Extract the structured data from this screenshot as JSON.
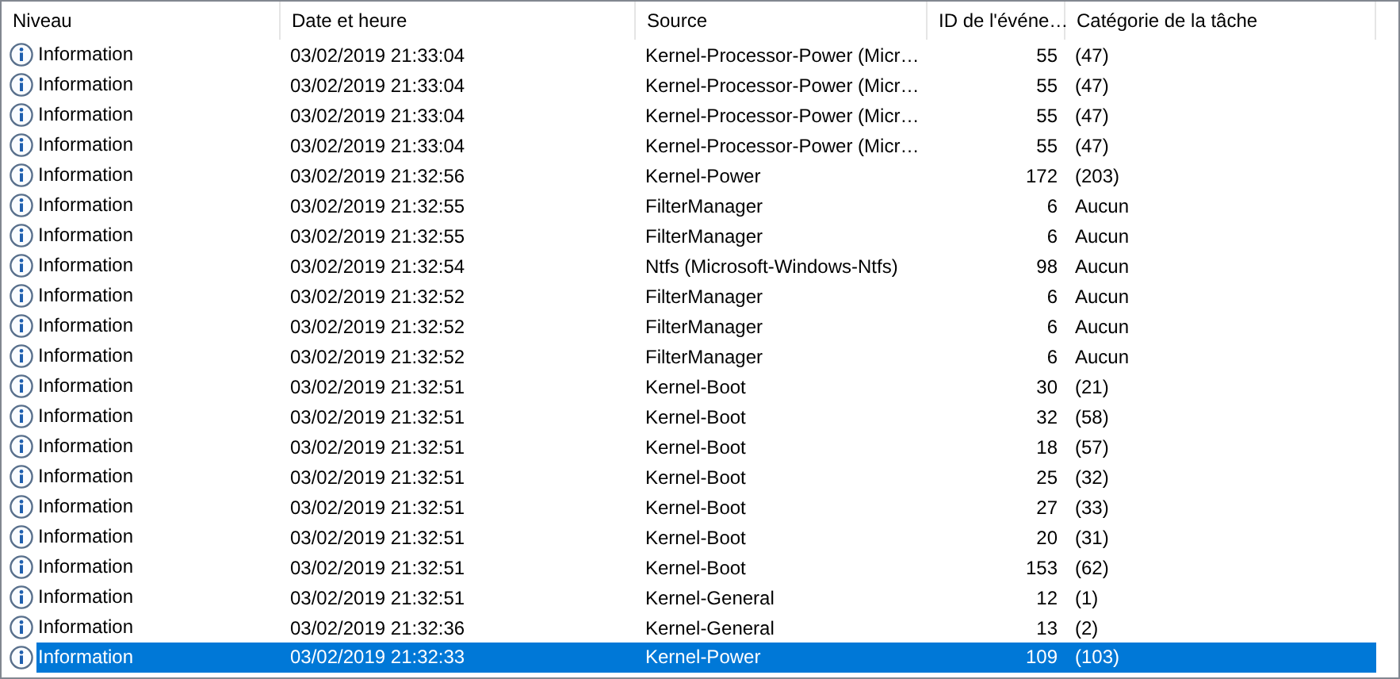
{
  "table": {
    "columns": [
      "Niveau",
      "Date et heure",
      "Source",
      "ID de l'événe…",
      "Catégorie de la tâche"
    ],
    "rows": [
      {
        "level": "Information",
        "date": "03/02/2019 21:33:04",
        "source": "Kernel-Processor-Power (Micr…",
        "id": "55",
        "category": "(47)",
        "selected": false
      },
      {
        "level": "Information",
        "date": "03/02/2019 21:33:04",
        "source": "Kernel-Processor-Power (Micr…",
        "id": "55",
        "category": "(47)",
        "selected": false
      },
      {
        "level": "Information",
        "date": "03/02/2019 21:33:04",
        "source": "Kernel-Processor-Power (Micr…",
        "id": "55",
        "category": "(47)",
        "selected": false
      },
      {
        "level": "Information",
        "date": "03/02/2019 21:33:04",
        "source": "Kernel-Processor-Power (Micr…",
        "id": "55",
        "category": "(47)",
        "selected": false
      },
      {
        "level": "Information",
        "date": "03/02/2019 21:32:56",
        "source": "Kernel-Power",
        "id": "172",
        "category": "(203)",
        "selected": false
      },
      {
        "level": "Information",
        "date": "03/02/2019 21:32:55",
        "source": "FilterManager",
        "id": "6",
        "category": "Aucun",
        "selected": false
      },
      {
        "level": "Information",
        "date": "03/02/2019 21:32:55",
        "source": "FilterManager",
        "id": "6",
        "category": "Aucun",
        "selected": false
      },
      {
        "level": "Information",
        "date": "03/02/2019 21:32:54",
        "source": "Ntfs (Microsoft-Windows-Ntfs)",
        "id": "98",
        "category": "Aucun",
        "selected": false
      },
      {
        "level": "Information",
        "date": "03/02/2019 21:32:52",
        "source": "FilterManager",
        "id": "6",
        "category": "Aucun",
        "selected": false
      },
      {
        "level": "Information",
        "date": "03/02/2019 21:32:52",
        "source": "FilterManager",
        "id": "6",
        "category": "Aucun",
        "selected": false
      },
      {
        "level": "Information",
        "date": "03/02/2019 21:32:52",
        "source": "FilterManager",
        "id": "6",
        "category": "Aucun",
        "selected": false
      },
      {
        "level": "Information",
        "date": "03/02/2019 21:32:51",
        "source": "Kernel-Boot",
        "id": "30",
        "category": "(21)",
        "selected": false
      },
      {
        "level": "Information",
        "date": "03/02/2019 21:32:51",
        "source": "Kernel-Boot",
        "id": "32",
        "category": "(58)",
        "selected": false
      },
      {
        "level": "Information",
        "date": "03/02/2019 21:32:51",
        "source": "Kernel-Boot",
        "id": "18",
        "category": "(57)",
        "selected": false
      },
      {
        "level": "Information",
        "date": "03/02/2019 21:32:51",
        "source": "Kernel-Boot",
        "id": "25",
        "category": "(32)",
        "selected": false
      },
      {
        "level": "Information",
        "date": "03/02/2019 21:32:51",
        "source": "Kernel-Boot",
        "id": "27",
        "category": "(33)",
        "selected": false
      },
      {
        "level": "Information",
        "date": "03/02/2019 21:32:51",
        "source": "Kernel-Boot",
        "id": "20",
        "category": "(31)",
        "selected": false
      },
      {
        "level": "Information",
        "date": "03/02/2019 21:32:51",
        "source": "Kernel-Boot",
        "id": "153",
        "category": "(62)",
        "selected": false
      },
      {
        "level": "Information",
        "date": "03/02/2019 21:32:51",
        "source": "Kernel-General",
        "id": "12",
        "category": "(1)",
        "selected": false
      },
      {
        "level": "Information",
        "date": "03/02/2019 21:32:36",
        "source": "Kernel-General",
        "id": "13",
        "category": "(2)",
        "selected": false
      },
      {
        "level": "Information",
        "date": "03/02/2019 21:32:33",
        "source": "Kernel-Power",
        "id": "109",
        "category": "(103)",
        "selected": true
      }
    ]
  }
}
